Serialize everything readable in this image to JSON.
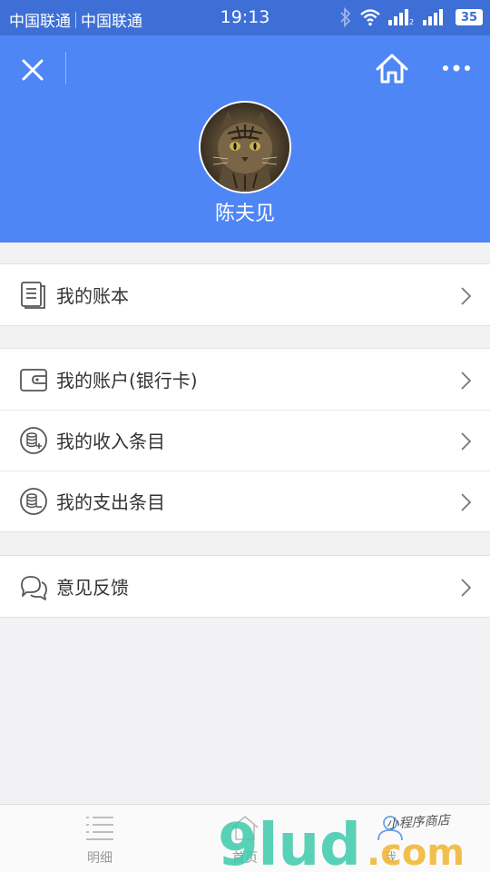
{
  "status_bar": {
    "carrier1": "中国联通",
    "carrier2": "中国联通",
    "time": "19:13",
    "battery": "35"
  },
  "header": {
    "background_color": "#4f86f5",
    "username": "陈夫见",
    "icons": [
      "close-icon",
      "home-icon",
      "more-icon"
    ]
  },
  "menu": {
    "groups": [
      {
        "items": [
          {
            "label": "我的账本",
            "icon": "ledger-icon"
          }
        ]
      },
      {
        "items": [
          {
            "label": "我的账户(银行卡)",
            "icon": "wallet-icon"
          },
          {
            "label": "我的收入条目",
            "icon": "income-icon"
          },
          {
            "label": "我的支出条目",
            "icon": "expense-icon"
          }
        ]
      },
      {
        "items": [
          {
            "label": "意见反馈",
            "icon": "feedback-icon"
          }
        ]
      }
    ]
  },
  "tabbar": {
    "tabs": [
      {
        "label": "明细",
        "icon": "list-icon"
      },
      {
        "label": "首页",
        "icon": "home-icon"
      },
      {
        "label": "我",
        "icon": "user-icon"
      }
    ]
  },
  "watermark": {
    "brand": "9lud",
    "domain": ".com",
    "tagline": "小程序商店"
  }
}
